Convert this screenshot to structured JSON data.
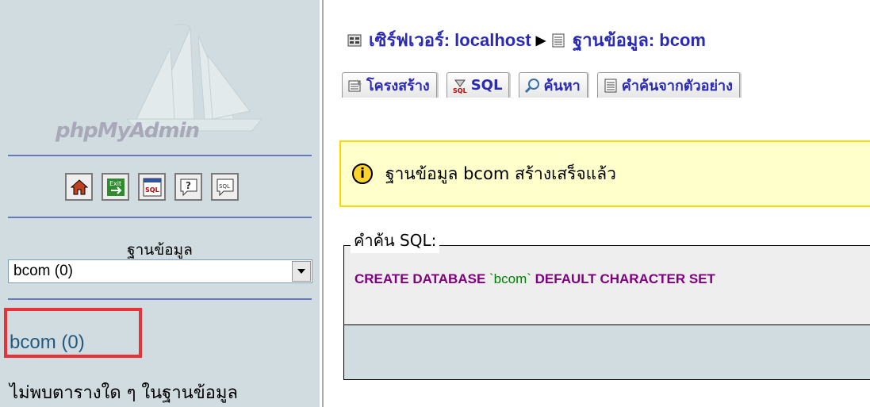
{
  "sidebar": {
    "logo_text": "phpMyAdmin",
    "toolbar_icons": [
      "home-icon",
      "exit-icon",
      "sql-query-icon",
      "help-icon",
      "sql-docs-icon"
    ],
    "database_label": "ฐานข้อมูล",
    "database_select_value": "bcom (0)",
    "database_link": "bcom (0)",
    "no_tables_text": "ไม่พบตารางใด ๆ ในฐานข้อมูล"
  },
  "breadcrumb": {
    "server": "เซิร์ฟเวอร์: localhost",
    "separator": "▶",
    "database": "ฐานข้อมูล: bcom"
  },
  "tabs": [
    {
      "label": "โครงสร้าง",
      "icon": "structure-icon"
    },
    {
      "label": "SQL",
      "icon": "sql-icon"
    },
    {
      "label": "ค้นหา",
      "icon": "search-icon"
    },
    {
      "label": "คำค้นจากตัวอย่าง",
      "icon": "query-by-example-icon"
    }
  ],
  "notice": {
    "icon_glyph": "i",
    "text": "ฐานข้อมูล bcom สร้างเสร็จแล้ว"
  },
  "sql_box": {
    "legend": "คำค้น SQL:",
    "query_prefix": "CREATE DATABASE ",
    "query_name": "`bcom`",
    "query_suffix": " DEFAULT CHARACTER SET"
  },
  "colors": {
    "sidebar_bg": "#d0dce0",
    "link_blue": "#2a2ab5",
    "highlight_red": "#e8323a",
    "notice_bg": "#ffffcc",
    "sql_keyword": "#800080"
  }
}
